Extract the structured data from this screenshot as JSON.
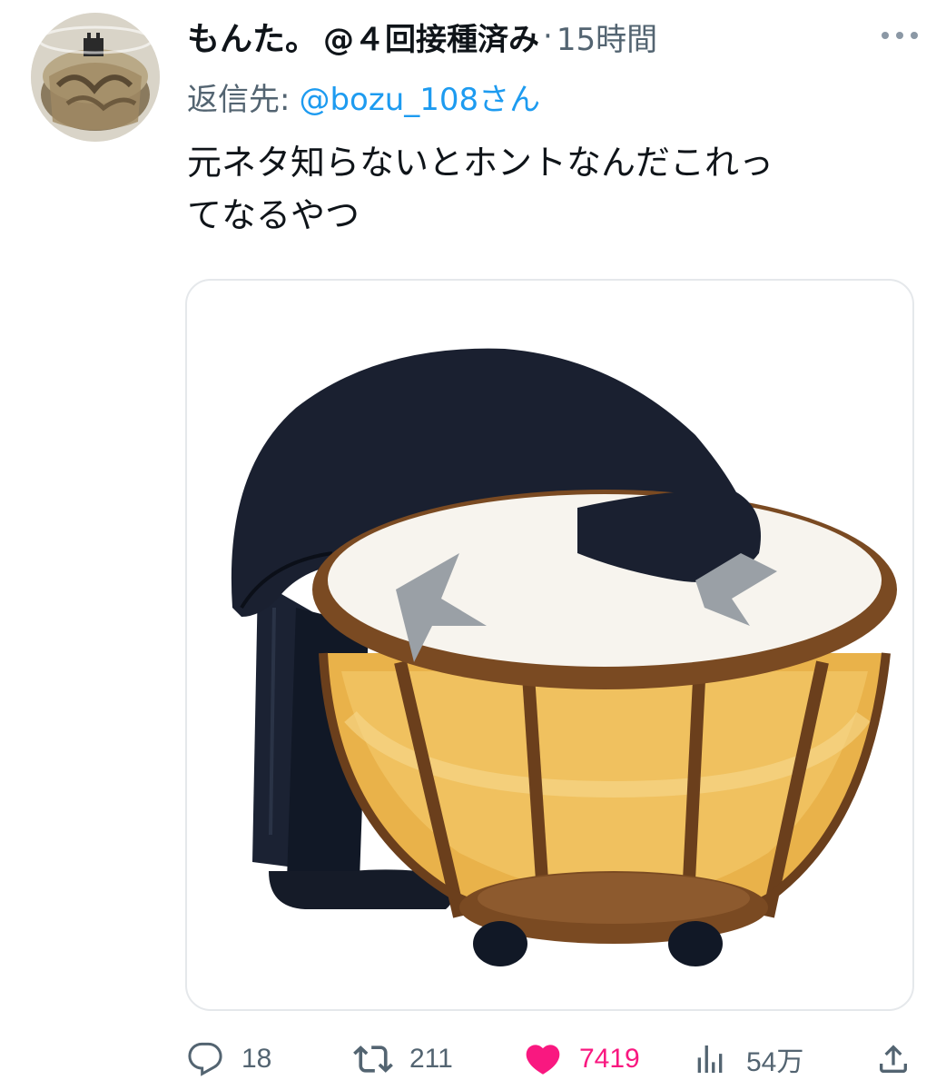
{
  "tweet": {
    "display_name": "もんた。",
    "handle": "@４回接種済み",
    "separator": "·",
    "time": "15時間",
    "more_icon": "more-dots-icon",
    "reply_label": "返信先:",
    "reply_target": "@bozu_108さん",
    "text_line1": "元ネタ知らないとホントなんだこれっ",
    "text_line2": "てなるやつ"
  },
  "actions": {
    "replies": "18",
    "retweets": "211",
    "likes": "7419",
    "views": "54万"
  },
  "colors": {
    "accent": "#1d9bf0",
    "like": "#f91880",
    "secondary": "#536471"
  }
}
